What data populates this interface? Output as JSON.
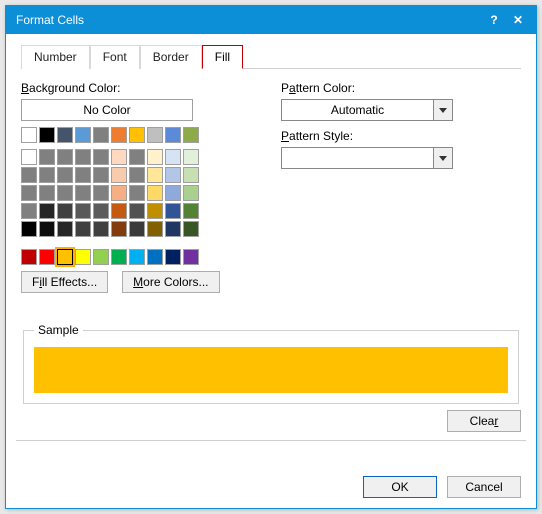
{
  "window": {
    "title": "Format Cells"
  },
  "tabs": {
    "number": "Number",
    "font": "Font",
    "border": "Border",
    "fill": "Fill",
    "active": "fill"
  },
  "labels": {
    "background_color": "Background Color:",
    "no_color": "No Color",
    "pattern_color": "Pattern Color:",
    "pattern_style": "Pattern Style:",
    "automatic": "Automatic",
    "sample": "Sample"
  },
  "buttons": {
    "fill_effects": "Fill Effects...",
    "more_colors": "More Colors...",
    "clear": "Clear",
    "ok": "OK",
    "cancel": "Cancel"
  },
  "colors": {
    "row0": [
      "#ffffff",
      "#000000",
      "#44546a",
      "#5b9bd5",
      "#808080",
      "#ed7d31",
      "#ffc000",
      "#bfbfbf",
      "#5b8bd8",
      "#8faa4b"
    ],
    "theme": [
      [
        "#ffffff",
        "#808080",
        "#808080",
        "#808080",
        "#808080",
        "#ffd8c2",
        "#808080",
        "#fff2cc",
        "#d6e3f3",
        "#e2efda"
      ],
      [
        "#808080",
        "#808080",
        "#808080",
        "#808080",
        "#808080",
        "#f8cbad",
        "#808080",
        "#ffe699",
        "#b4c6e7",
        "#c6e0b4"
      ],
      [
        "#808080",
        "#808080",
        "#808080",
        "#808080",
        "#808080",
        "#f4b084",
        "#808080",
        "#ffd966",
        "#8ea9db",
        "#a9d08e"
      ],
      [
        "#808080",
        "#262626",
        "#404040",
        "#595959",
        "#5b5b5b",
        "#c65911",
        "#525252",
        "#bf8f00",
        "#305496",
        "#548235"
      ],
      [
        "#000000",
        "#0d0d0d",
        "#262626",
        "#404040",
        "#404040",
        "#833c0c",
        "#3a3a3a",
        "#806000",
        "#203764",
        "#375623"
      ]
    ],
    "standard": [
      "#c00000",
      "#ff0000",
      "#ffc000",
      "#ffff00",
      "#92d050",
      "#00b050",
      "#00b0f0",
      "#0070c0",
      "#002060",
      "#7030a0"
    ],
    "selected": "#ffc000",
    "pattern_style_value": ""
  },
  "sample_color": "#ffc000"
}
